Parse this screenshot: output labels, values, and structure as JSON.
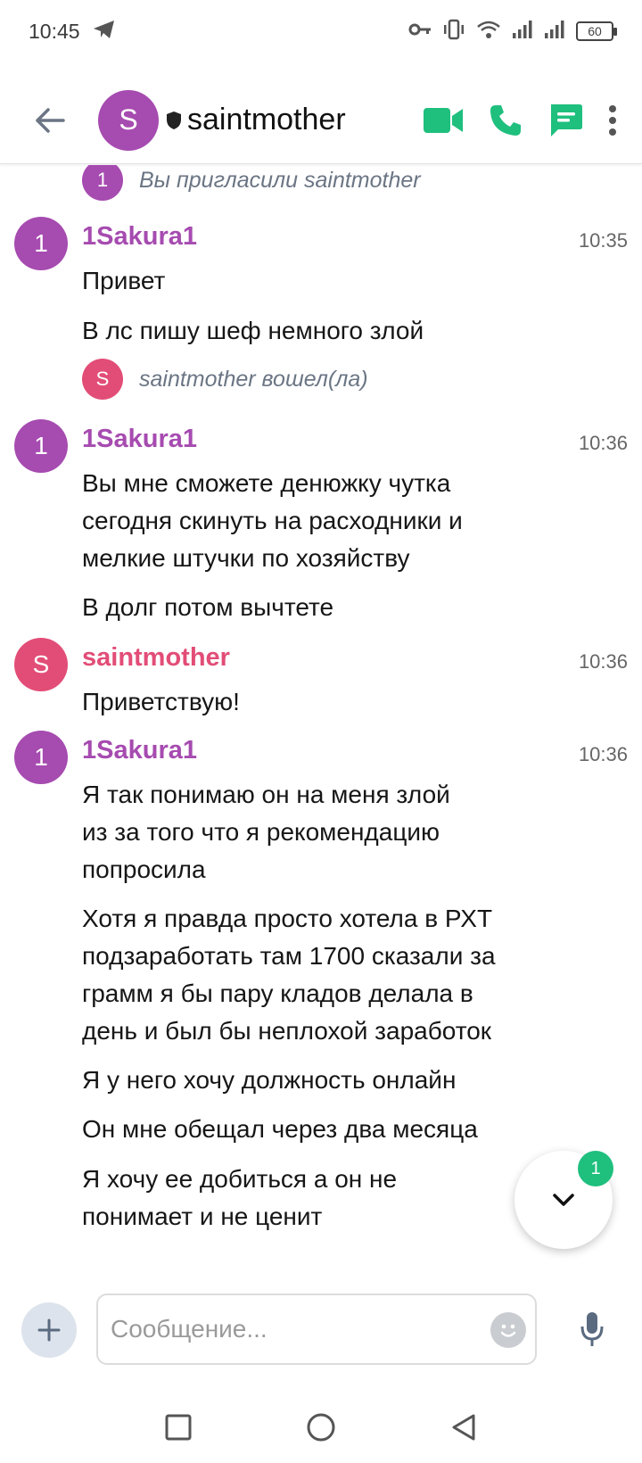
{
  "status_bar": {
    "time": "10:45",
    "battery": "60"
  },
  "header": {
    "avatar_letter": "S",
    "title": "saintmother"
  },
  "messages": {
    "invite": {
      "avatar_letter": "1",
      "text": "Вы пригласили saintmother"
    },
    "joined": {
      "avatar_letter": "S",
      "text": "saintmother вошел(ла)"
    },
    "m1": {
      "avatar_letter": "1",
      "author": "1Sakura1",
      "time": "10:35",
      "lines": [
        "Привет",
        "В лс пишу шеф немного злой"
      ]
    },
    "m2": {
      "avatar_letter": "1",
      "author": "1Sakura1",
      "time": "10:36",
      "lines": [
        "Вы мне сможете денюжку чутка",
        "сегодня скинуть на расходники и",
        "мелкие штучки по хозяйству",
        "В долг потом вычтете"
      ]
    },
    "m3": {
      "avatar_letter": "S",
      "author": "saintmother",
      "time": "10:36",
      "lines": [
        "Приветствую!"
      ]
    },
    "m4": {
      "avatar_letter": "1",
      "author": "1Sakura1",
      "time": "10:36",
      "lines": [
        "Я так понимаю он на меня злой",
        "из за того что я рекомендацию",
        "попросила",
        "Хотя я правда просто хотела в РХТ",
        "подзаработать там 1700 сказали за",
        "грамм я бы пару кладов делала в",
        "день и был бы неплохой заработок",
        "Я у него хочу должность онлайн",
        "Он мне обещал через два месяца",
        "Я хочу ее добиться а он не",
        "понимает и не ценит"
      ]
    }
  },
  "scroll_fab": {
    "badge": "1"
  },
  "composer": {
    "placeholder": "Сообщение..."
  },
  "colors": {
    "purple": "#a64bb0",
    "pink": "#e24d77",
    "green": "#1fbf7e"
  },
  "icons": [
    "back-arrow-icon",
    "shield-icon",
    "video-call-icon",
    "phone-icon",
    "threads-icon",
    "more-vert-icon",
    "chevron-down-icon",
    "plus-icon",
    "emoji-icon",
    "mic-icon"
  ]
}
